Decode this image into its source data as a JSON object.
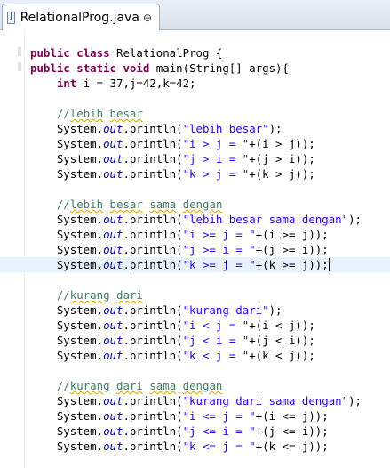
{
  "tab": {
    "title": "RelationalProg.java",
    "close": "⊖",
    "icon_letter": "J"
  },
  "code": {
    "l1": {
      "kw1": "public",
      "kw2": "class",
      "rest": " RelationalProg {"
    },
    "l2": {
      "kw1": "public",
      "kw2": "static",
      "kw3": "void",
      "rest": " main(String[] args){"
    },
    "l3": {
      "kw": "int",
      "rest": " i = 37,j=42,k=42;"
    },
    "s1": {
      "comment_slash": "//",
      "comment_words": [
        "lebih",
        "besar"
      ],
      "lines": [
        {
          "head": "System.",
          "field": "out",
          "mid": ".println(",
          "str": "\"lebih besar\"",
          "tail": ");"
        },
        {
          "head": "System.",
          "field": "out",
          "mid": ".println(",
          "str": "\"i > j = \"",
          "tail": "+(i > j));"
        },
        {
          "head": "System.",
          "field": "out",
          "mid": ".println(",
          "str": "\"j > i = \"",
          "tail": "+(j > i));"
        },
        {
          "head": "System.",
          "field": "out",
          "mid": ".println(",
          "str": "\"k > j = \"",
          "tail": "+(k > j));"
        }
      ]
    },
    "s2": {
      "comment_slash": "//",
      "comment_words": [
        "lebih",
        "besar",
        "sama",
        "dengan"
      ],
      "lines": [
        {
          "head": "System.",
          "field": "out",
          "mid": ".println(",
          "str": "\"lebih besar sama dengan\"",
          "tail": ");"
        },
        {
          "head": "System.",
          "field": "out",
          "mid": ".println(",
          "str": "\"i >= j = \"",
          "tail": "+(i >= j));"
        },
        {
          "head": "System.",
          "field": "out",
          "mid": ".println(",
          "str": "\"j >= i = \"",
          "tail": "+(j >= i));"
        },
        {
          "head": "System.",
          "field": "out",
          "mid": ".println(",
          "str": "\"k >= j = \"",
          "tail": "+(k >= j));"
        }
      ]
    },
    "s3": {
      "comment_slash": "//",
      "comment_words": [
        "kurang",
        "dari"
      ],
      "lines": [
        {
          "head": "System.",
          "field": "out",
          "mid": ".println(",
          "str": "\"kurang dari\"",
          "tail": ");"
        },
        {
          "head": "System.",
          "field": "out",
          "mid": ".println(",
          "str": "\"i < j = \"",
          "tail": "+(i < j));"
        },
        {
          "head": "System.",
          "field": "out",
          "mid": ".println(",
          "str": "\"j < i = \"",
          "tail": "+(j < i));"
        },
        {
          "head": "System.",
          "field": "out",
          "mid": ".println(",
          "str": "\"k < j = \"",
          "tail": "+(k < j));"
        }
      ]
    },
    "s4": {
      "comment_slash": "//",
      "comment_words": [
        "kurang",
        "dari",
        "sama",
        "dengan"
      ],
      "lines": [
        {
          "head": "System.",
          "field": "out",
          "mid": ".println(",
          "str": "\"kurang dari sama dengan\"",
          "tail": ");"
        },
        {
          "head": "System.",
          "field": "out",
          "mid": ".println(",
          "str": "\"i <= j = \"",
          "tail": "+(i <= j));"
        },
        {
          "head": "System.",
          "field": "out",
          "mid": ".println(",
          "str": "\"j <= i = \"",
          "tail": "+(j <= i));"
        },
        {
          "head": "System.",
          "field": "out",
          "mid": ".println(",
          "str": "\"k <= j = \"",
          "tail": "+(k <= j));"
        }
      ]
    }
  },
  "colors": {
    "keyword": "#7f0055",
    "string": "#2a00ff",
    "comment": "#3f7f5f",
    "field": "#0000c0",
    "current_line": "#e8f2fe"
  }
}
